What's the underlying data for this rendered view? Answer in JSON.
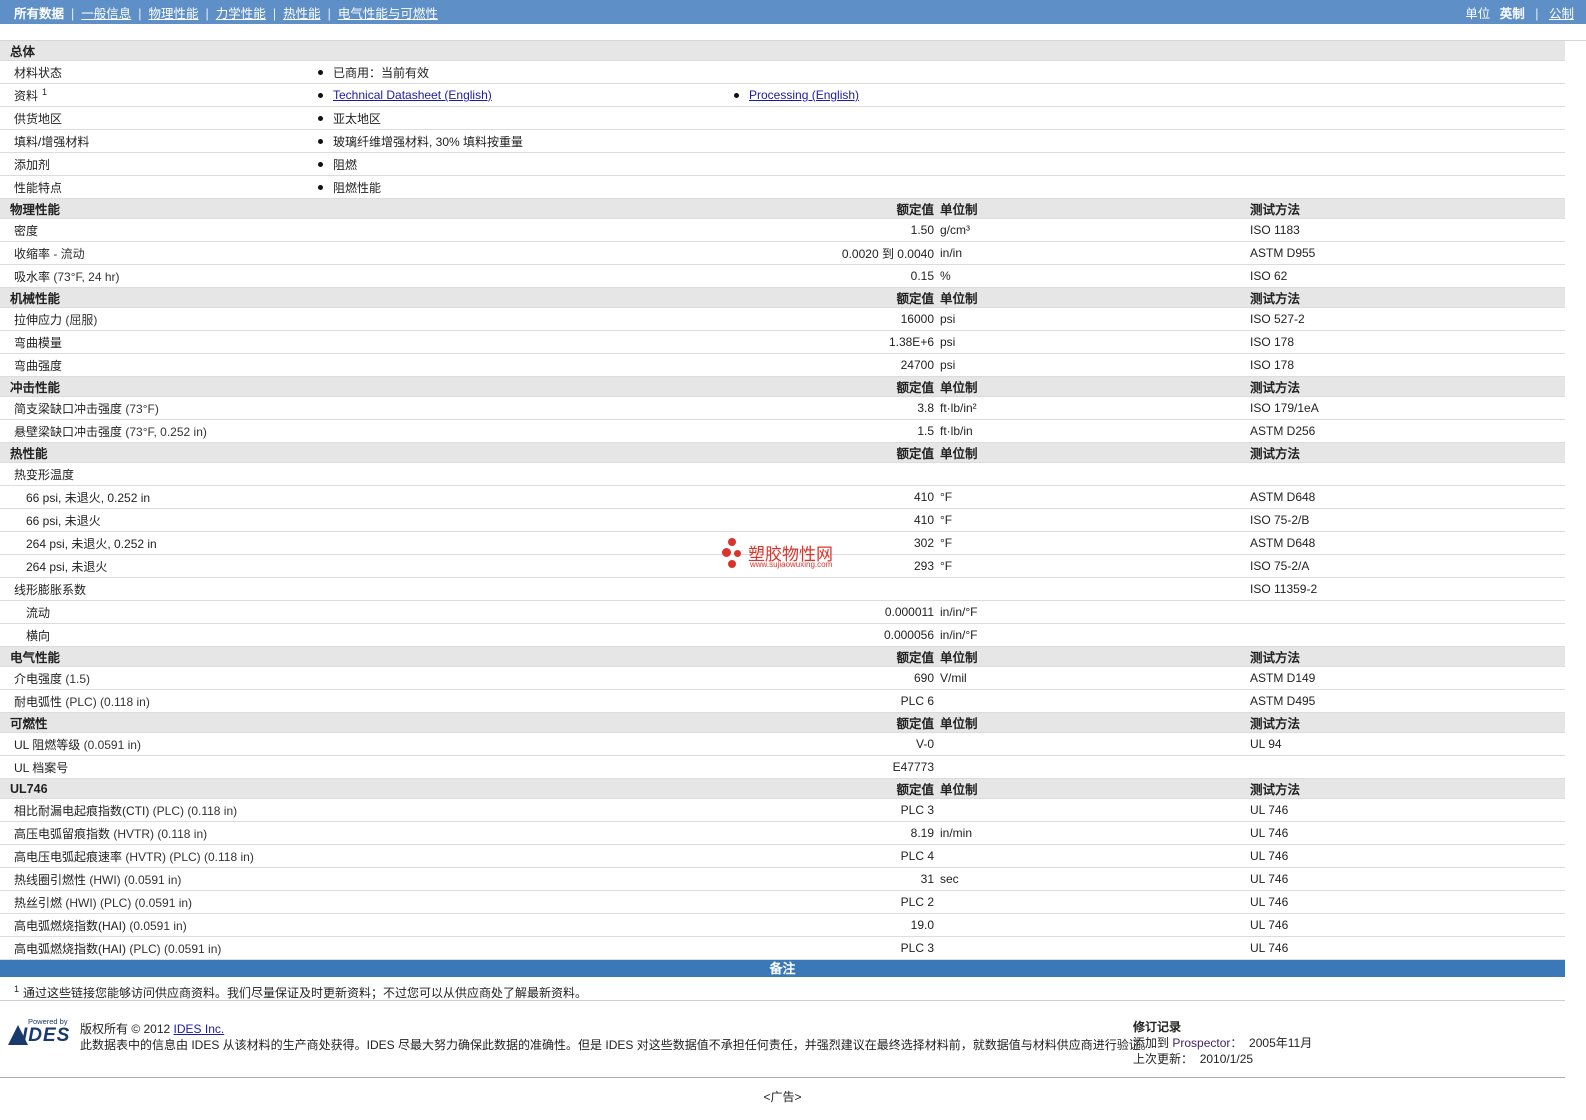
{
  "nav": {
    "items": [
      "所有数据",
      "一般信息",
      "物理性能",
      "力学性能",
      "热性能",
      "电气性能与可燃性"
    ],
    "units_label": "单位",
    "units_current": "英制",
    "units_alt": "公制"
  },
  "table_headers": {
    "value": "额定值",
    "unit": "单位制",
    "method": "测试方法"
  },
  "general": {
    "title": "总体",
    "rows": [
      {
        "name": "材料状态",
        "items": [
          "已商用：当前有效"
        ]
      },
      {
        "name": "资料",
        "sup": "1",
        "links": [
          "Technical Datasheet (English)",
          "Processing (English)"
        ]
      },
      {
        "name": "供货地区",
        "items": [
          "亚太地区"
        ]
      },
      {
        "name": "填料/增强材料",
        "items": [
          "玻璃纤维增强材料, 30% 填料按重量"
        ]
      },
      {
        "name": "添加剂",
        "items": [
          "阻燃"
        ]
      },
      {
        "name": "性能特点",
        "items": [
          "阻燃性能"
        ]
      }
    ]
  },
  "sections": [
    {
      "title": "物理性能",
      "rows": [
        {
          "name": "密度",
          "cond": "",
          "value": "1.50",
          "unit": "g/cm³",
          "method": "ISO 1183"
        },
        {
          "name": "收缩率",
          "cond": " - 流动",
          "value": "0.0020 到  0.0040",
          "unit": "in/in",
          "method": "ASTM D955"
        },
        {
          "name": "吸水率",
          "cond": " (73°F, 24 hr)",
          "value": "0.15",
          "unit": "%",
          "method": "ISO 62"
        }
      ]
    },
    {
      "title": "机械性能",
      "rows": [
        {
          "name": "拉伸应力",
          "cond": " (屈服)",
          "value": "16000",
          "unit": "psi",
          "method": "ISO 527-2"
        },
        {
          "name": "弯曲模量",
          "cond": "",
          "value": "1.38E+6",
          "unit": "psi",
          "method": "ISO 178"
        },
        {
          "name": "弯曲强度",
          "cond": "",
          "value": "24700",
          "unit": "psi",
          "method": "ISO 178"
        }
      ]
    },
    {
      "title": "冲击性能",
      "rows": [
        {
          "name": "简支梁缺口冲击强度",
          "cond": " (73°F)",
          "value": "3.8",
          "unit": "ft·lb/in²",
          "method": "ISO 179/1eA"
        },
        {
          "name": "悬壁梁缺口冲击强度",
          "cond": " (73°F, 0.252 in)",
          "value": "1.5",
          "unit": "ft·lb/in",
          "method": "ASTM D256"
        }
      ]
    },
    {
      "title": "热性能",
      "rows": [
        {
          "name": "热变形温度",
          "cond": "",
          "value": "",
          "unit": "",
          "method": ""
        },
        {
          "name": "66 psi, 未退火, 0.252 in",
          "sub": true,
          "cond": "",
          "value": "410",
          "unit": "°F",
          "method": "ASTM D648"
        },
        {
          "name": "66 psi, 未退火",
          "sub": true,
          "cond": "",
          "value": "410",
          "unit": "°F",
          "method": "ISO 75-2/B"
        },
        {
          "name": "264 psi, 未退火, 0.252 in",
          "sub": true,
          "cond": "",
          "value": "302",
          "unit": "°F",
          "method": "ASTM D648"
        },
        {
          "name": "264 psi, 未退火",
          "sub": true,
          "cond": "",
          "value": "293",
          "unit": "°F",
          "method": "ISO 75-2/A"
        },
        {
          "name": "线形膨胀系数",
          "cond": "",
          "value": "",
          "unit": "",
          "method": "ISO 11359-2"
        },
        {
          "name": "流动",
          "sub": true,
          "cond": "",
          "value": "0.000011",
          "unit": "in/in/°F",
          "method": ""
        },
        {
          "name": "横向",
          "sub": true,
          "cond": "",
          "value": "0.000056",
          "unit": "in/in/°F",
          "method": ""
        }
      ]
    },
    {
      "title": "电气性能",
      "rows": [
        {
          "name": "介电强度",
          "cond": " (1.5)",
          "value": "690",
          "unit": "V/mil",
          "method": "ASTM D149"
        },
        {
          "name": "耐电弧性",
          "cond": " (PLC) (0.118 in)",
          "value": "PLC 6",
          "unit": "",
          "method": "ASTM D495"
        }
      ]
    },
    {
      "title": "可燃性",
      "rows": [
        {
          "name": "UL 阻燃等级",
          "cond": " (0.0591 in)",
          "value": "V-0",
          "unit": "",
          "method": "UL 94"
        },
        {
          "name": "UL 档案号",
          "cond": "",
          "value": "E47773",
          "unit": "",
          "method": ""
        }
      ]
    },
    {
      "title": "UL746",
      "rows": [
        {
          "name": "相比耐漏电起痕指数(CTI)",
          "cond": " (PLC) (0.118 in)",
          "value": "PLC 3",
          "unit": "",
          "method": "UL 746"
        },
        {
          "name": "高压电弧留痕指数",
          "cond": " (HVTR) (0.118 in)",
          "value": "8.19",
          "unit": "in/min",
          "method": "UL 746"
        },
        {
          "name": "高电压电弧起痕速率",
          "cond": " (HVTR) (PLC) (0.118 in)",
          "value": "PLC 4",
          "unit": "",
          "method": "UL 746"
        },
        {
          "name": "热线圈引燃性",
          "cond": " (HWI) (0.0591 in)",
          "value": "31",
          "unit": "sec",
          "method": "UL 746"
        },
        {
          "name": "热丝引燃",
          "cond": " (HWI) (PLC) (0.0591 in)",
          "value": "PLC 2",
          "unit": "",
          "method": "UL 746"
        },
        {
          "name": "高电弧燃烧指数(HAI)",
          "cond": " (0.0591 in)",
          "value": "19.0",
          "unit": "",
          "method": "UL 746"
        },
        {
          "name": "高电弧燃烧指数(HAI)",
          "cond": " (PLC) (0.0591 in)",
          "value": "PLC 3",
          "unit": "",
          "method": "UL 746"
        }
      ]
    }
  ],
  "notes": {
    "title": "备注",
    "sup": "1",
    "text": "通过这些链接您能够访问供应商资料。我们尽量保证及时更新资料；不过您可以从供应商处了解最新资料。"
  },
  "footer": {
    "powered_by": "Powered by",
    "logo_word": "IDES",
    "copyright_prefix": "版权所有 © 2012 ",
    "company": "IDES Inc.",
    "disclaimer": "此数据表中的信息由 IDES 从该材料的生产商处获得。IDES 尽最大努力确保此数据的准确性。但是 IDES 对这些数据值不承担任何责任，并强烈建议在最终选择材料前，就数据值与材料供应商进行验证。",
    "rev_title": "修订记录",
    "added_label": "添加到 ",
    "added_app": "Prospector：",
    "added_date": "2005年11月",
    "updated_label": "上次更新：",
    "updated_date": "2010/1/25"
  },
  "ad": "<广告>",
  "watermark": {
    "text": "塑胶物性网",
    "url": "www.sujiaowuxing.com"
  }
}
